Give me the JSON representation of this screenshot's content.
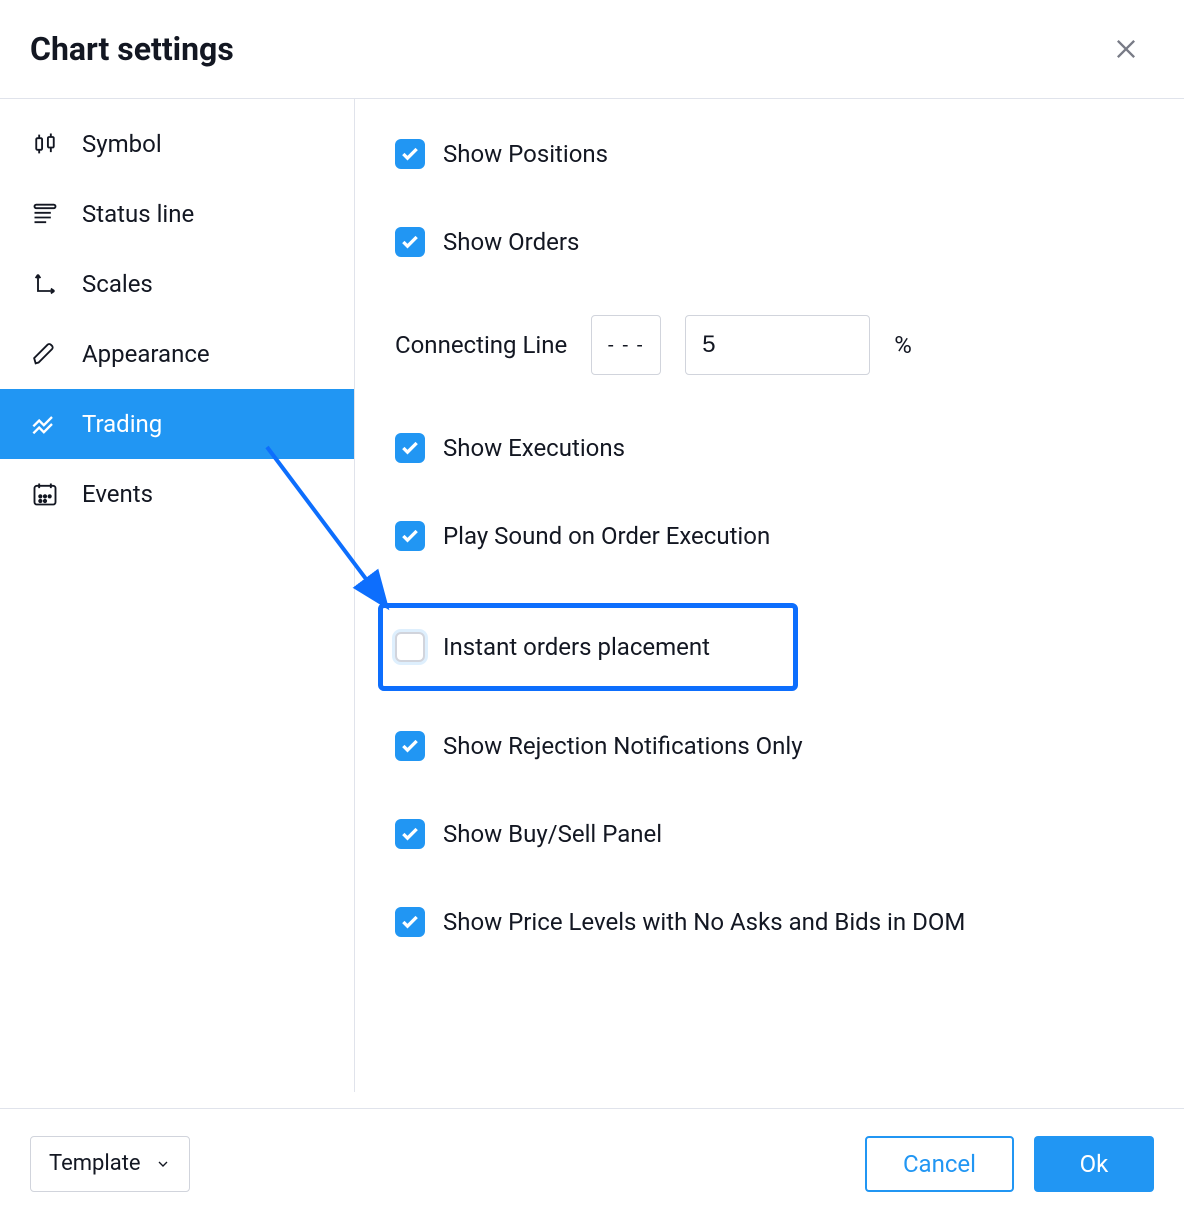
{
  "header": {
    "title": "Chart settings"
  },
  "sidebar": {
    "items": [
      {
        "label": "Symbol"
      },
      {
        "label": "Status line"
      },
      {
        "label": "Scales"
      },
      {
        "label": "Appearance"
      },
      {
        "label": "Trading"
      },
      {
        "label": "Events"
      }
    ]
  },
  "content": {
    "show_positions": "Show Positions",
    "show_orders": "Show Orders",
    "connecting_line_label": "Connecting Line",
    "connecting_style": "- - -",
    "connecting_value": "5",
    "connecting_unit": "%",
    "show_executions": "Show Executions",
    "play_sound": "Play Sound on Order Execution",
    "instant_orders": "Instant orders placement",
    "show_rejection": "Show Rejection Notifications Only",
    "show_buy_sell": "Show Buy/Sell Panel",
    "show_price_levels": "Show Price Levels with No Asks and Bids in DOM"
  },
  "footer": {
    "template": "Template",
    "cancel": "Cancel",
    "ok": "Ok"
  }
}
